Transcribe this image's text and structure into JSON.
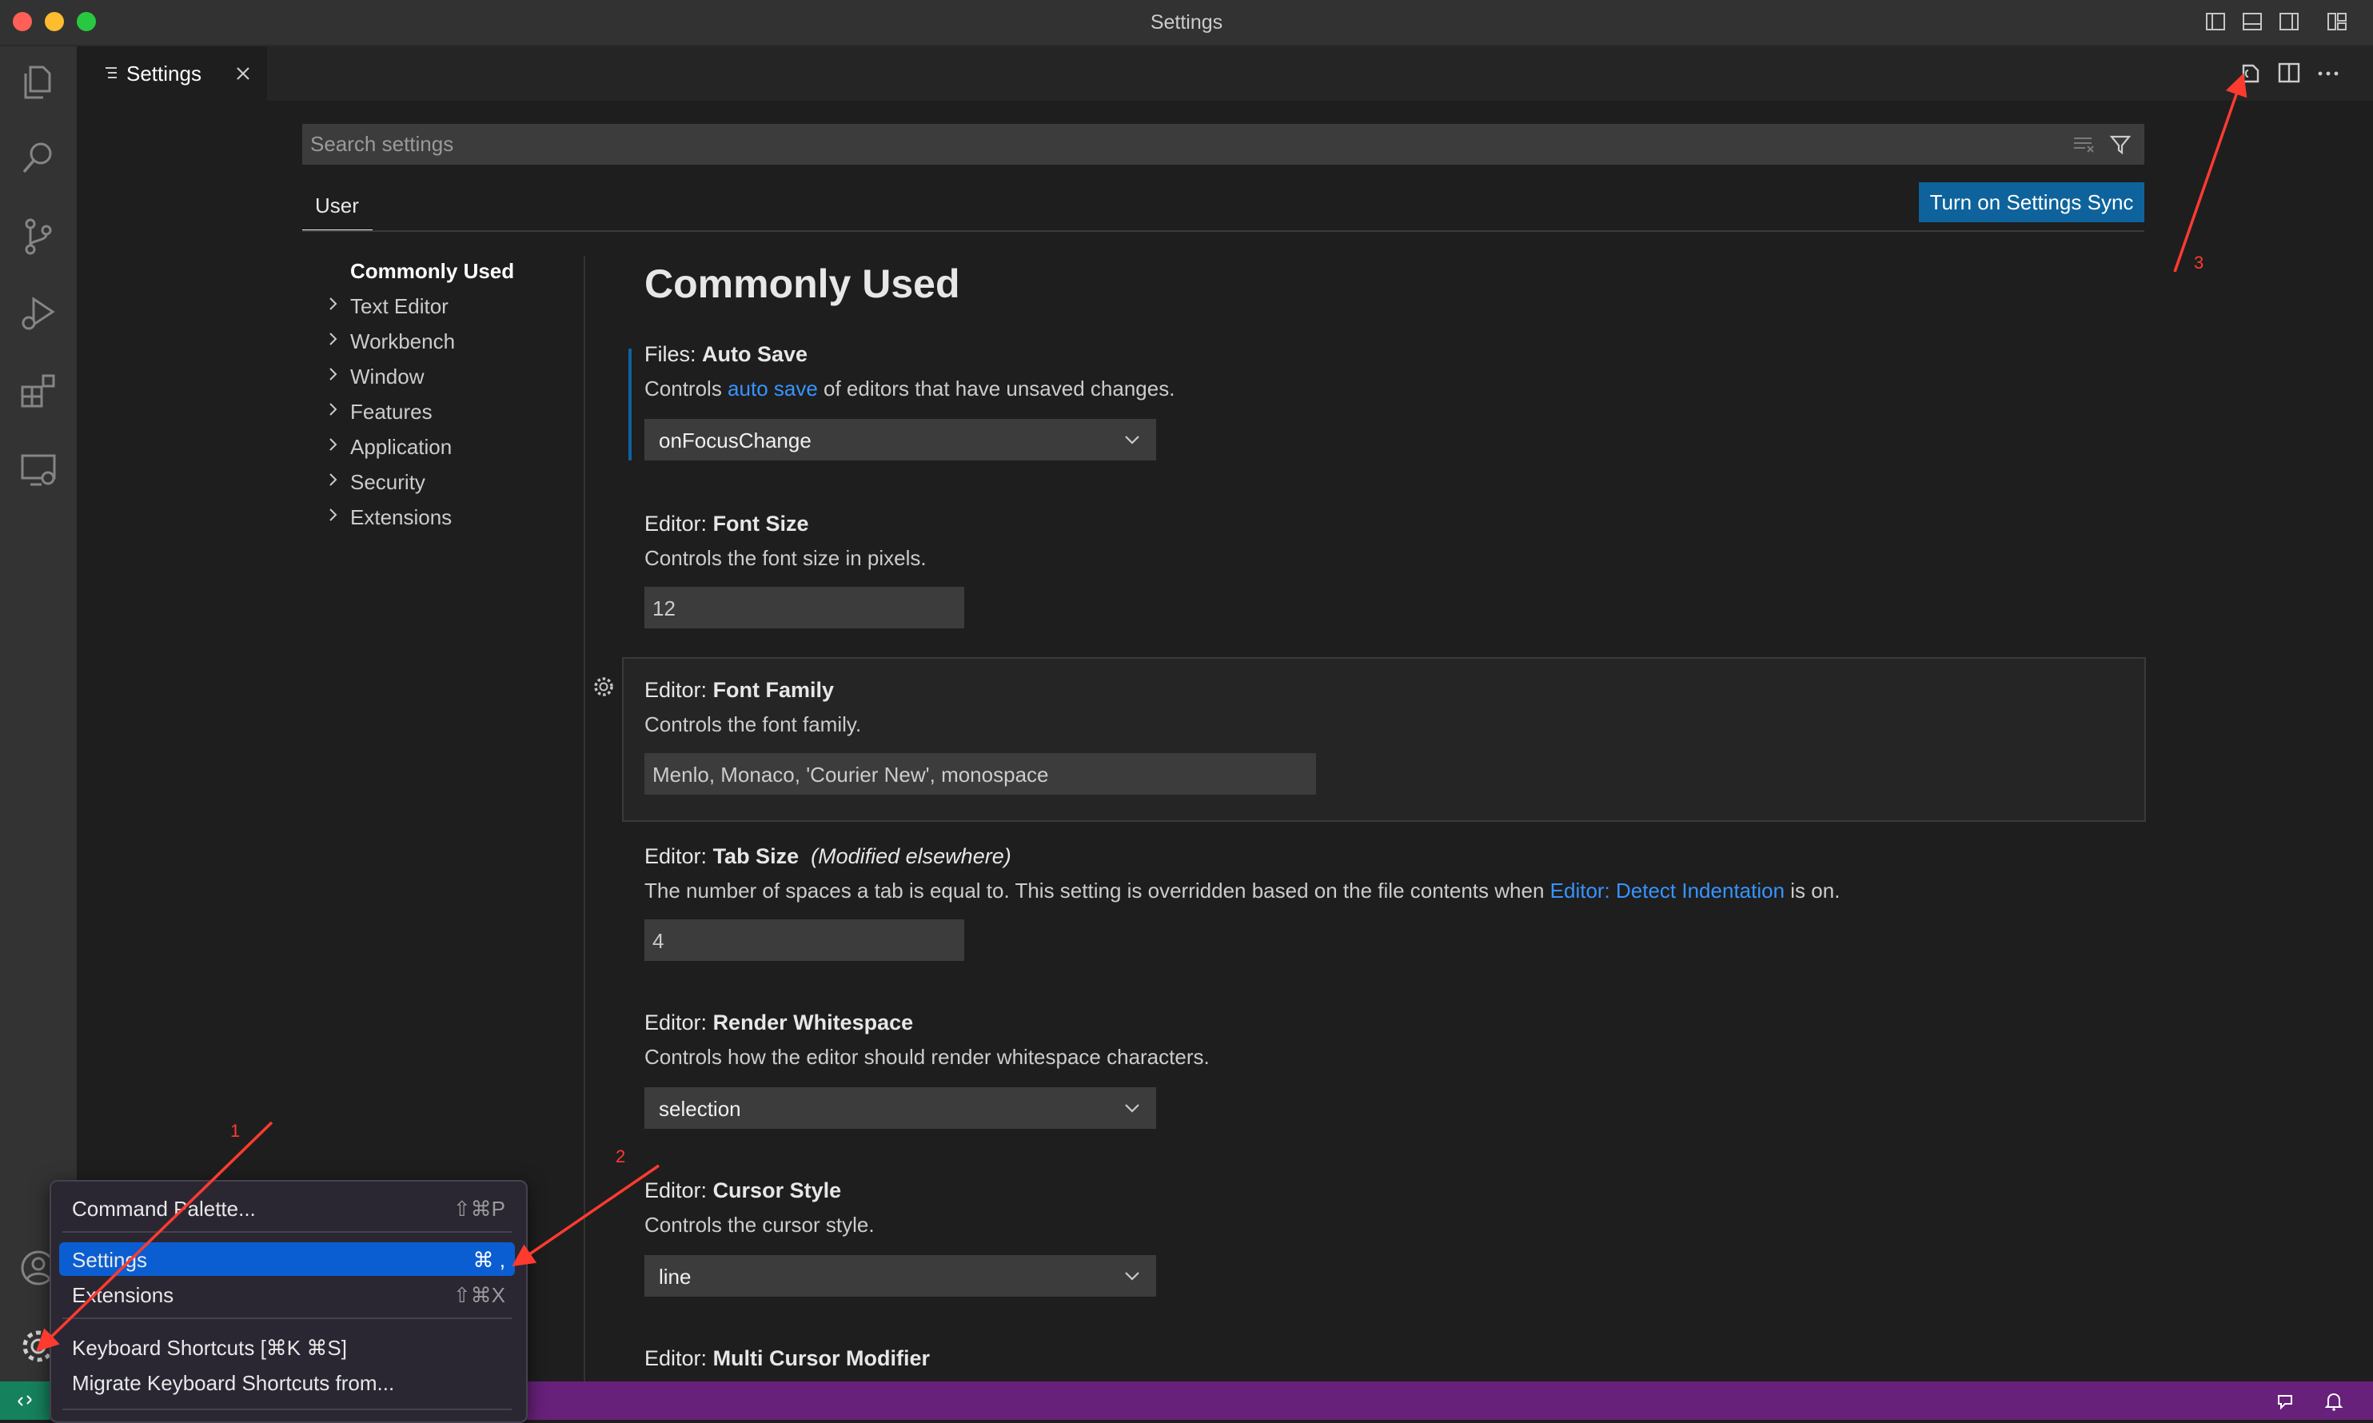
{
  "window": {
    "title": "Settings"
  },
  "tab": {
    "label": "Settings"
  },
  "search": {
    "placeholder": "Search settings"
  },
  "scope_tab": {
    "label": "User"
  },
  "sync_button": {
    "label": "Turn on Settings Sync"
  },
  "toc": {
    "items": [
      {
        "label": "Commonly Used",
        "selected": true
      },
      {
        "label": "Text Editor"
      },
      {
        "label": "Workbench"
      },
      {
        "label": "Window"
      },
      {
        "label": "Features"
      },
      {
        "label": "Application"
      },
      {
        "label": "Security"
      },
      {
        "label": "Extensions"
      }
    ]
  },
  "main": {
    "heading": "Commonly Used",
    "settings": {
      "auto_save": {
        "category": "Files:",
        "name": "Auto Save",
        "desc_pre": "Controls ",
        "desc_link": "auto save",
        "desc_post": " of editors that have unsaved changes.",
        "value": "onFocusChange"
      },
      "font_size": {
        "category": "Editor:",
        "name": "Font Size",
        "desc": "Controls the font size in pixels.",
        "value": "12"
      },
      "font_family": {
        "category": "Editor:",
        "name": "Font Family",
        "desc": "Controls the font family.",
        "value": "Menlo, Monaco, 'Courier New', monospace"
      },
      "tab_size": {
        "category": "Editor:",
        "name": "Tab Size",
        "modified": "(Modified elsewhere)",
        "desc_pre": "The number of spaces a tab is equal to. This setting is overridden based on the file contents when ",
        "desc_link": "Editor: Detect Indentation",
        "desc_post": " is on.",
        "value": "4"
      },
      "render_whitespace": {
        "category": "Editor:",
        "name": "Render Whitespace",
        "desc": "Controls how the editor should render whitespace characters.",
        "value": "selection"
      },
      "cursor_style": {
        "category": "Editor:",
        "name": "Cursor Style",
        "desc": "Controls the cursor style.",
        "value": "line"
      },
      "multi_cursor": {
        "category": "Editor:",
        "name": "Multi Cursor Modifier"
      }
    }
  },
  "menu": {
    "items": [
      {
        "label": "Command Palette...",
        "shortcut": "⇧⌘P"
      },
      {
        "label": "Settings",
        "shortcut": "⌘ ,",
        "highlighted": true
      },
      {
        "label": "Extensions",
        "shortcut": "⇧⌘X"
      },
      {
        "label": "Keyboard Shortcuts [⌘K ⌘S]",
        "shortcut": ""
      },
      {
        "label": "Migrate Keyboard Shortcuts from...",
        "shortcut": ""
      }
    ]
  },
  "annotations": [
    "1",
    "2",
    "3"
  ],
  "colors": {
    "accent": "#0e639c",
    "link": "#3794ff",
    "statusbar": "#68217a",
    "remote": "#16825d",
    "menu_highlight": "#0b5ed1",
    "annotation": "#ff3b30"
  }
}
